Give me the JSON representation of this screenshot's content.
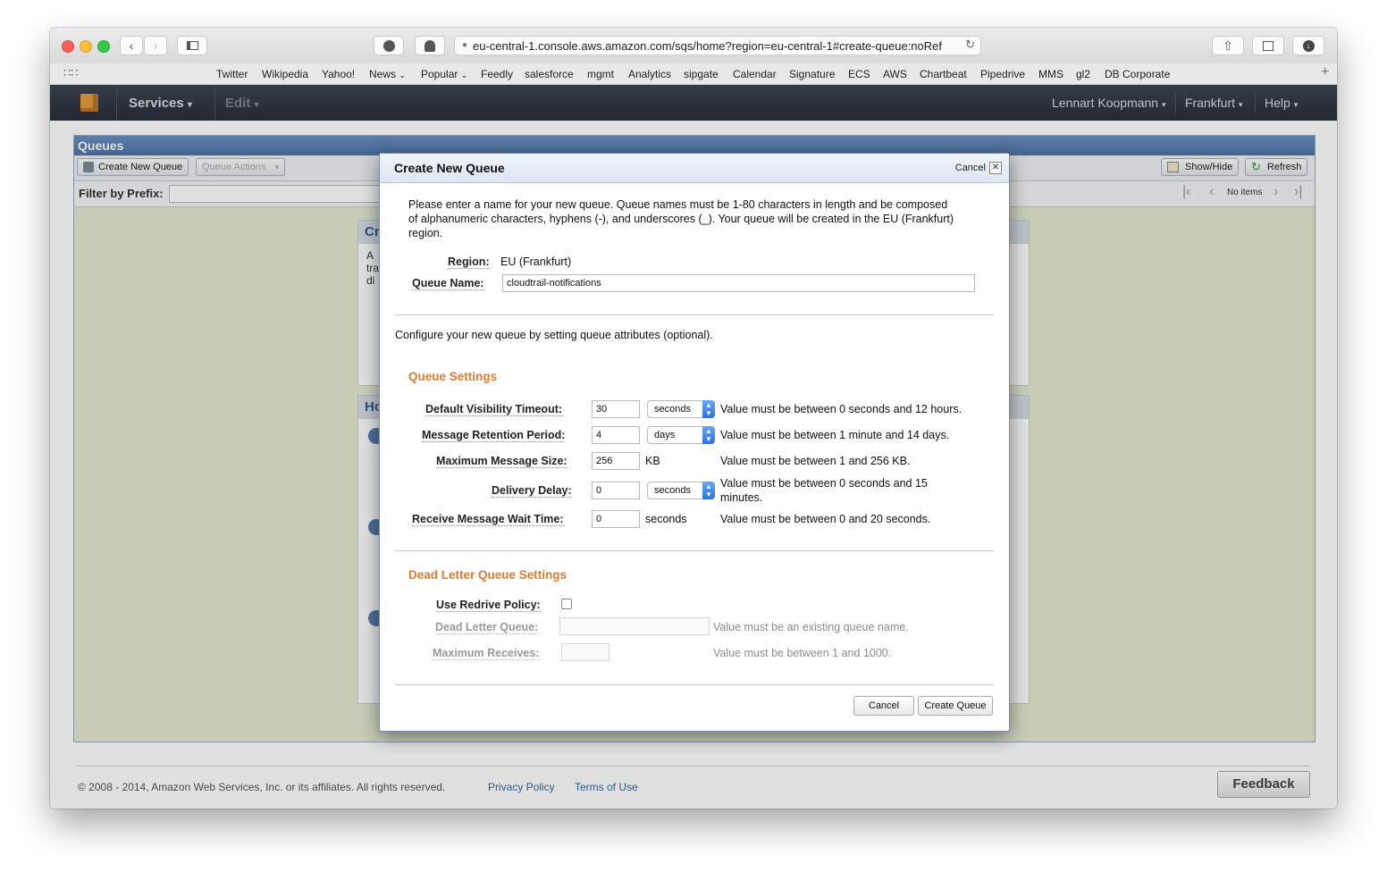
{
  "browser": {
    "url": "eu-central-1.console.aws.amazon.com/sqs/home?region=eu-central-1#create-queue:noRef",
    "bookmarks": [
      "Twitter",
      "Wikipedia",
      "Yahoo!",
      "News",
      "Popular",
      "Feedly",
      "salesforce",
      "mgmt",
      "Analytics",
      "sipgate",
      "Calendar",
      "Signature",
      "ECS",
      "AWS",
      "Chartbeat",
      "Pipedrive",
      "MMS",
      "gl2",
      "DB Corporate"
    ]
  },
  "nav": {
    "services": "Services",
    "edit": "Edit",
    "user": "Lennart Koopmann",
    "region": "Frankfurt",
    "help": "Help"
  },
  "queues": {
    "title": "Queues",
    "create_btn": "Create New Queue",
    "actions_btn": "Queue Actions",
    "showhide_btn": "Show/Hide",
    "refresh_btn": "Refresh",
    "filter_label": "Filter by Prefix:",
    "no_items": "No items",
    "bg_card1_title": "Cr",
    "bg_card1_lines": [
      "A",
      "tra",
      "di"
    ],
    "bg_card2_title": "Ho"
  },
  "footer": {
    "copyright": "© 2008 - 2014, Amazon Web Services, Inc. or its affiliates. All rights reserved.",
    "privacy": "Privacy Policy",
    "terms": "Terms of Use",
    "feedback": "Feedback"
  },
  "modal": {
    "title": "Create New Queue",
    "cancel_link": "Cancel",
    "intro_lines": [
      "Please enter a name for your new queue. Queue names must be 1-80 characters in length and be composed",
      "of alphanumeric characters, hyphens (-), and underscores (_). Your queue will be created in the EU (Frankfurt)",
      "region."
    ],
    "region_label": "Region:",
    "region_value": "EU (Frankfurt)",
    "queue_name_label": "Queue Name:",
    "queue_name_value": "cloudtrail-notifications",
    "configure_text": "Configure your new queue by setting queue attributes (optional).",
    "queue_settings_title": "Queue Settings",
    "settings": {
      "visibility": {
        "label": "Default Visibility Timeout:",
        "value": "30",
        "unit": "seconds",
        "hint": "Value must be between 0 seconds and 12 hours."
      },
      "retention": {
        "label": "Message Retention Period:",
        "value": "4",
        "unit": "days",
        "hint": "Value must be between 1 minute and 14 days."
      },
      "max_size": {
        "label": "Maximum Message Size:",
        "value": "256",
        "unit": "KB",
        "hint": "Value must be between 1 and 256 KB."
      },
      "delay": {
        "label": "Delivery Delay:",
        "value": "0",
        "unit": "seconds",
        "hint_line1": "Value must be between 0 seconds and 15",
        "hint_line2": "minutes."
      },
      "wait": {
        "label": "Receive Message Wait Time:",
        "value": "0",
        "unit": "seconds",
        "hint": "Value must be between 0 and 20 seconds."
      }
    },
    "dlq_title": "Dead Letter Queue Settings",
    "redrive_label": "Use Redrive Policy:",
    "dlq_label": "Dead Letter Queue:",
    "dlq_hint": "Value must be an existing queue name.",
    "max_receives_label": "Maximum Receives:",
    "max_receives_hint": "Value must be between 1 and 1000.",
    "cancel_btn": "Cancel",
    "create_btn": "Create Queue"
  }
}
